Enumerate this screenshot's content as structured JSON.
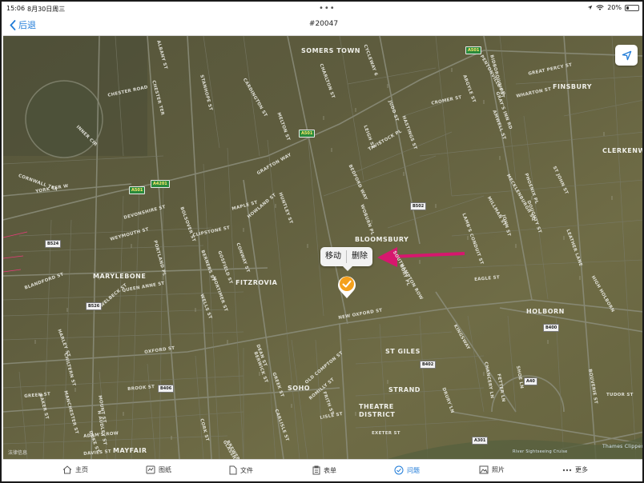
{
  "status_bar": {
    "time": "15:06",
    "date": "8月30日周三",
    "battery": "20%",
    "battery_level": 0.2
  },
  "nav": {
    "back_label": "后退",
    "title": "#20047"
  },
  "map": {
    "areas": [
      "SOMERS TOWN",
      "FINSBURY",
      "CLERKENWELL",
      "BLOOMSBURY",
      "FITZROVIA",
      "MARYLEBONE",
      "HOLBORN",
      "ST GILES",
      "SOHO",
      "STRAND",
      "THEATRE\nDISTRICT",
      "MAYFAIR"
    ],
    "streets": [
      "KING'S CROSS",
      "CHESTER ROAD",
      "CHESTER TER",
      "ALBANY ST",
      "STANHOPE ST",
      "CARDINGTON ST",
      "MELTON ST",
      "GRAFTON WAY",
      "HUNTLEY ST",
      "BEDFORD WAY",
      "WOBURN PL",
      "TAVISTOCK PL",
      "CROMER ST",
      "GREAT PERCY ST",
      "WHARTON ST",
      "AMWELL ST",
      "CORNWALL TER",
      "YORK TER W",
      "DEVONSHIRE ST",
      "WEYMOUTH ST",
      "PORTLAND PL",
      "CLIPSTONE ST",
      "MAPLE ST",
      "HOWLAND ST",
      "BOLSOVER ST",
      "QUEEN ANNE ST",
      "WELBECK ST",
      "BLANDFORD ST",
      "NEW OXFORD ST",
      "OXFORD ST",
      "BROOK ST",
      "GREEN ST",
      "DEAN ST",
      "OLD COMPTON ST",
      "ROMILLY ST",
      "LISLE ST",
      "KINGSWAY",
      "EAGLE ST",
      "HIGH HOLBORN",
      "LEATHER LANE",
      "ST JOHN ST",
      "TUDOR ST",
      "BOUVERIE ST",
      "ADAM'S ROW",
      "MOUNT ST",
      "CHARLTON ST",
      "JUDD ST",
      "LEIGH ST",
      "GRAY'S INN RD",
      "LAMB'S CONDUIT ST",
      "CYCLEWAY 6",
      "PHOENIX PL",
      "INNER CIR",
      "PENTONVILLE RD",
      "BERWICK ST",
      "CARLISLE ST",
      "MORTIMER ST",
      "GOSFIELD ST",
      "CONWAY ST",
      "BERNERS ST",
      "WELLS ST",
      "HARLEY ST",
      "CHILTERN ST",
      "BAKER ST",
      "MANCHESTER ST",
      "DUKE ST",
      "N AUDLEY ST",
      "DAVIES ST",
      "CORK ST",
      "GREEK ST",
      "FRITH ST",
      "BREWER ST",
      "GLASSHOUSE ST",
      "SOUTHAMPTON ROW",
      "BURY PL",
      "DRURY LN",
      "EXETER ST",
      "CHANCERY LN",
      "FETTER LN",
      "SHOE LN",
      "MILLMAN ST",
      "JOHN ST",
      "DOUGHTY ST",
      "MECKLENBURGH SQ",
      "HASTINGS ST",
      "ARGYLE ST",
      "BIDBOROUGH ST"
    ],
    "road_signs": [
      "A501",
      "A501",
      "A501",
      "A4201",
      "B502",
      "B524",
      "B526",
      "B406",
      "B402",
      "B400",
      "A40",
      "A301"
    ],
    "river_label": "Thames Clippers",
    "service_label": "River Sightseeing Cruise",
    "legal": "法律信息",
    "popover": {
      "move": "移动",
      "delete": "删除"
    },
    "pin_color": "#f4a01c"
  },
  "tabs": [
    {
      "label": "主页",
      "icon": "home-icon",
      "active": false
    },
    {
      "label": "图纸",
      "icon": "drawing-icon",
      "active": false
    },
    {
      "label": "文件",
      "icon": "file-icon",
      "active": false
    },
    {
      "label": "表单",
      "icon": "form-icon",
      "active": false
    },
    {
      "label": "问题",
      "icon": "issue-icon",
      "active": true
    },
    {
      "label": "照片",
      "icon": "photo-icon",
      "active": false
    },
    {
      "label": "更多",
      "icon": "more-icon",
      "active": false
    }
  ],
  "colors": {
    "accent": "#1f7bd8",
    "arrow": "#d6176e",
    "map_bg": "#6b6a44"
  }
}
